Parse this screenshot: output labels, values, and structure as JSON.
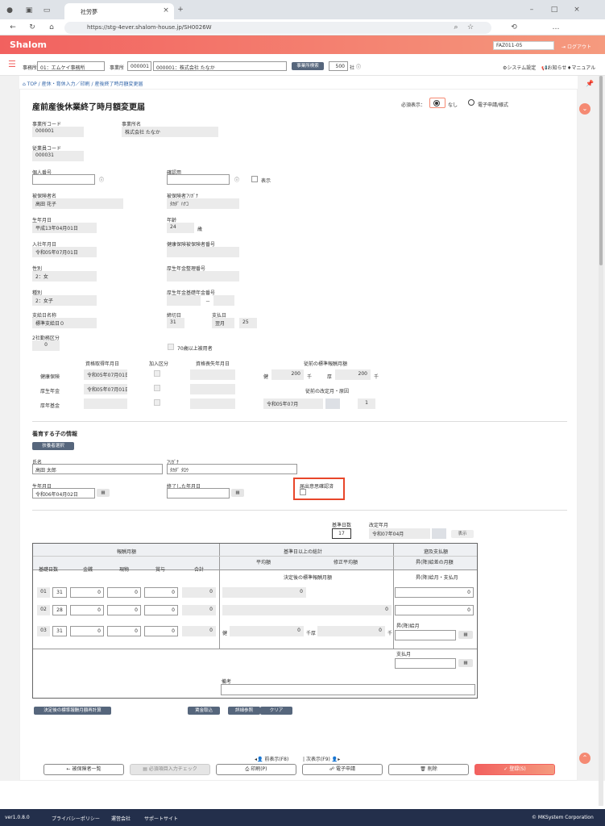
{
  "browser": {
    "tab_title": "社労夢",
    "url": "https://stg-4ever.shalom-house.jp/SH0026W"
  },
  "app": {
    "logo": "Shalom",
    "office_select": "FAZ011-05",
    "logout": "ログアウト"
  },
  "toolbar": {
    "office_label": "事務所",
    "office_value": "01：エムケイ事務所",
    "jigyosho_label": "事業所",
    "jigyosho_code": "000001",
    "jigyosho_name": "000001：株式会社 たなか",
    "search_btn": "事業所検索",
    "count": "500",
    "count_unit": "社",
    "sys": "システム設定",
    "notice": "お知らせ",
    "manual": "マニュアル"
  },
  "breadcrumb": {
    "top": "TOP",
    "b1": "産休・育休入力／印刷",
    "b2": "産後終了時月額変更届"
  },
  "page": {
    "title": "産前産後休業終了時月額変更届",
    "must_label": "必須表示：",
    "must_none": "なし",
    "must_e": "電子申請/様式"
  },
  "fields": {
    "jigyosho_code_l": "事業所コード",
    "jigyosho_code": "000001",
    "jigyosho_name_l": "事業所名",
    "jigyosho_name": "株式会社 たなか",
    "emp_code_l": "従業員コード",
    "emp_code": "000031",
    "mynumber_l": "個人番号",
    "confirm_l": "確認用",
    "show_l": "表示",
    "name_l": "被保険者名",
    "name": "高田 花子",
    "kana_l": "被保険者ﾌﾘｶﾞﾅ",
    "kana": "ﾀｶﾀﾞ ﾊﾅｺ",
    "birth_l": "生年月日",
    "birth": "平成13年04月01日",
    "age_l": "年齢",
    "age": "24",
    "age_unit": "歳",
    "join_l": "入社年月日",
    "join": "令和05年07月01日",
    "kenpo_l": "健康保険被保険者番号",
    "sex_l": "性別",
    "sex": "2：女",
    "kosei_l": "厚生年金整理番号",
    "kind_l": "種別",
    "kind": "2：女子",
    "kiso_l": "厚生年金基礎年金番号",
    "kiso_sep": "－",
    "pay_l": "支給日名称",
    "pay": "標準支給日０",
    "close_l": "締切日",
    "close": "31",
    "payday_l": "支払日",
    "payday_m": "翌月",
    "payday_d": "25",
    "two_l": "2社勤務区分",
    "two": "0",
    "over70": "70歳以上被用者"
  },
  "ins": {
    "h_get": "資格取得年月日",
    "h_join": "加入区分",
    "h_lose": "資格喪失年月日",
    "h_prev": "従前の標準報酬月額",
    "r1": "健康保険",
    "r1_date": "令和05年07月01日",
    "r2": "厚生年金",
    "r2_date": "令和05年07月01日",
    "r3": "厚年基金",
    "ken": "健",
    "ken_v": "200",
    "sen": "千",
    "ko": "厚",
    "ko_v": "200",
    "kaitei_l": "従前の改定月・原因",
    "kaitei": "令和05年07月",
    "kaitei_n": "1"
  },
  "child": {
    "section": "養育する子の情報",
    "select_btn": "扶養者選択",
    "name_l": "氏名",
    "name": "高田 太郎",
    "kana_l": "ﾌﾘｶﾞﾅ",
    "kana": "ﾀｶﾀﾞ ﾀﾛｳ",
    "birth_l": "生年月日",
    "birth": "令和06年04月02日",
    "end_l": "終了した年月日",
    "confirm_l": "届出意思確認済"
  },
  "calc": {
    "days_l": "基準日数",
    "days": "17",
    "rev_l": "改定年月",
    "rev": "令和07年04月",
    "show": "表示",
    "h_reward": "報酬月額",
    "h_base": "基準日以上の総計",
    "h_retro": "遡及支払額",
    "h_days": "基礎日数",
    "h_money": "金銭",
    "h_goods": "現物",
    "h_bonus": "賞与",
    "h_total": "合計",
    "h_avg": "平均額",
    "h_mod": "修正平均額",
    "h_prevm": "昇(降)給差の月額",
    "h_std": "決定後の標準報酬月額",
    "h_prevmon": "昇(降)給月・支払月",
    "rows": [
      {
        "m": "01",
        "d": "31"
      },
      {
        "m": "02",
        "d": "28"
      },
      {
        "m": "03",
        "d": "31"
      }
    ],
    "zero": "0",
    "ken": "健",
    "ko": "厚",
    "sen": "千",
    "up_l": "昇(降)給月",
    "pay_l": "支払月",
    "memo_l": "備考"
  },
  "actions": {
    "recalc": "決定後の標準報酬月額再計算",
    "wage": "賃金取込",
    "detail": "詳細参照",
    "clear": "クリア",
    "prev": "前表示(F8)",
    "next": "次表示(F9)",
    "list": "被保険者一覧",
    "check": "必須項目入力チェック",
    "print": "印刷(P)",
    "e": "電子申請",
    "del": "削除",
    "save": "登録(S)"
  },
  "footer": {
    "ver": "ver1.0.8.0",
    "privacy": "プライバシーポリシー",
    "company": "運営会社",
    "support": "サポートサイト",
    "copy": "© MKSystem Corporation"
  },
  "colors": {
    "brand": "#f2615f",
    "accent": "#f58a73",
    "nav": "#56667c",
    "highlight": "#e8462a"
  }
}
